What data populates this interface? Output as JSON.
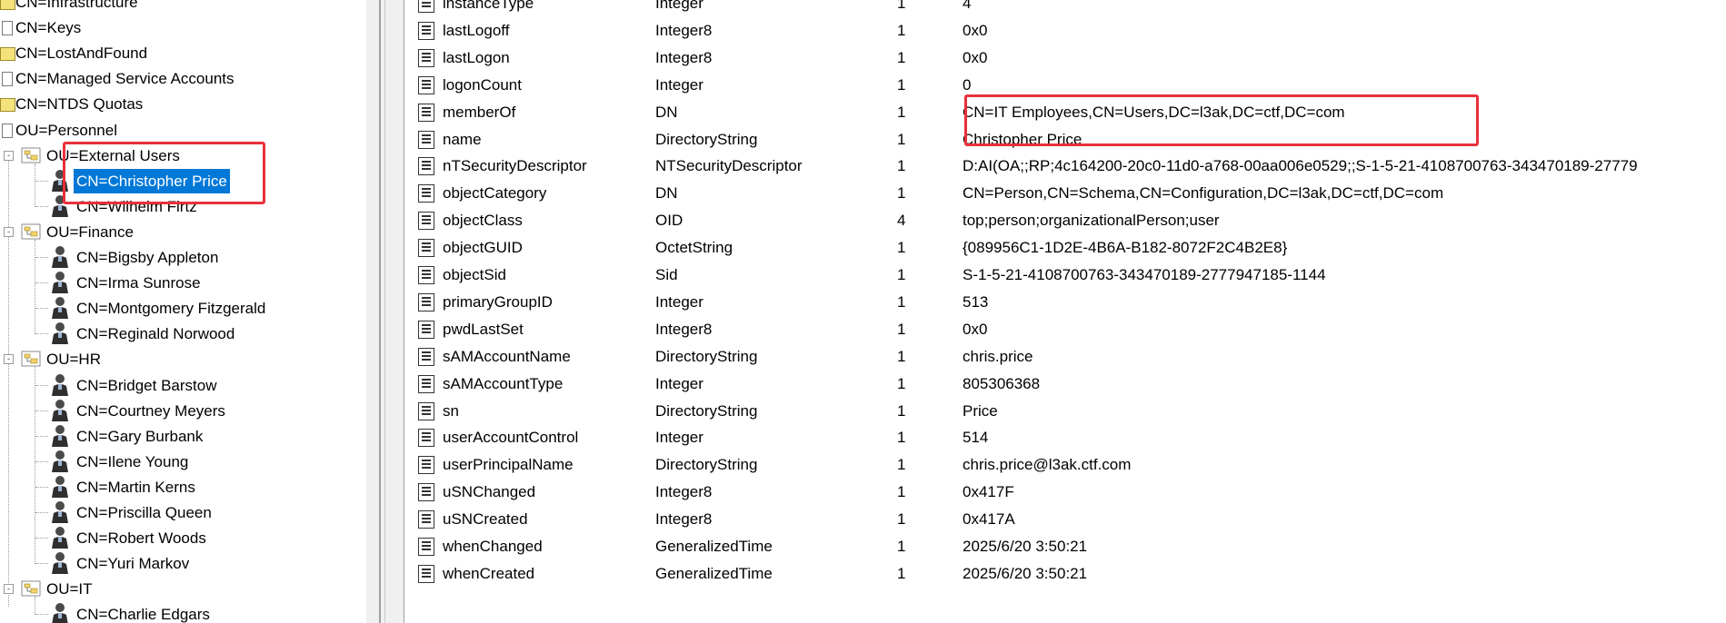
{
  "tree": {
    "items": [
      {
        "label": "CN=Infrastructure",
        "icon": "folder-icon"
      },
      {
        "label": "CN=Keys",
        "icon": "container-icon"
      },
      {
        "label": "CN=LostAndFound",
        "icon": "folder-icon"
      },
      {
        "label": "CN=Managed Service Accounts",
        "icon": "container-icon"
      },
      {
        "label": "CN=NTDS Quotas",
        "icon": "folder-icon"
      },
      {
        "label": "OU=Personnel",
        "icon": "container-icon"
      },
      {
        "label": "OU=External Users",
        "icon": "ou-icon"
      },
      {
        "label": "CN=Christopher Price",
        "icon": "user-icon",
        "selected": true
      },
      {
        "label": "CN=Wilhelm Firtz",
        "icon": "user-icon"
      },
      {
        "label": "OU=Finance",
        "icon": "ou-icon"
      },
      {
        "label": "CN=Bigsby Appleton",
        "icon": "user-icon"
      },
      {
        "label": "CN=Irma Sunrose",
        "icon": "user-icon"
      },
      {
        "label": "CN=Montgomery Fitzgerald",
        "icon": "user-icon"
      },
      {
        "label": "CN=Reginald Norwood",
        "icon": "user-icon"
      },
      {
        "label": "OU=HR",
        "icon": "ou-icon"
      },
      {
        "label": "CN=Bridget Barstow",
        "icon": "user-icon"
      },
      {
        "label": "CN=Courtney Meyers",
        "icon": "user-icon"
      },
      {
        "label": "CN=Gary Burbank",
        "icon": "user-icon"
      },
      {
        "label": "CN=Ilene Young",
        "icon": "user-icon"
      },
      {
        "label": "CN=Martin Kerns",
        "icon": "user-icon"
      },
      {
        "label": "CN=Priscilla Queen",
        "icon": "user-icon"
      },
      {
        "label": "CN=Robert Woods",
        "icon": "user-icon"
      },
      {
        "label": "CN=Yuri Markov",
        "icon": "user-icon"
      },
      {
        "label": "OU=IT",
        "icon": "ou-icon"
      },
      {
        "label": "CN=Charlie Edgars",
        "icon": "user-icon"
      }
    ]
  },
  "attributes": [
    {
      "name": "instanceType",
      "syntax": "Integer",
      "count": "1",
      "value": "4"
    },
    {
      "name": "lastLogoff",
      "syntax": "Integer8",
      "count": "1",
      "value": "0x0"
    },
    {
      "name": "lastLogon",
      "syntax": "Integer8",
      "count": "1",
      "value": "0x0"
    },
    {
      "name": "logonCount",
      "syntax": "Integer",
      "count": "1",
      "value": "0"
    },
    {
      "name": "memberOf",
      "syntax": "DN",
      "count": "1",
      "value": "CN=IT Employees,CN=Users,DC=l3ak,DC=ctf,DC=com"
    },
    {
      "name": "name",
      "syntax": "DirectoryString",
      "count": "1",
      "value": "Christopher Price"
    },
    {
      "name": "nTSecurityDescriptor",
      "syntax": "NTSecurityDescriptor",
      "count": "1",
      "value": "D:AI(OA;;RP;4c164200-20c0-11d0-a768-00aa006e0529;;S-1-5-21-4108700763-343470189-27779"
    },
    {
      "name": "objectCategory",
      "syntax": "DN",
      "count": "1",
      "value": "CN=Person,CN=Schema,CN=Configuration,DC=l3ak,DC=ctf,DC=com"
    },
    {
      "name": "objectClass",
      "syntax": "OID",
      "count": "4",
      "value": "top;person;organizationalPerson;user"
    },
    {
      "name": "objectGUID",
      "syntax": "OctetString",
      "count": "1",
      "value": "{089956C1-1D2E-4B6A-B182-8072F2C4B2E8}"
    },
    {
      "name": "objectSid",
      "syntax": "Sid",
      "count": "1",
      "value": "S-1-5-21-4108700763-343470189-2777947185-1144"
    },
    {
      "name": "primaryGroupID",
      "syntax": "Integer",
      "count": "1",
      "value": "513"
    },
    {
      "name": "pwdLastSet",
      "syntax": "Integer8",
      "count": "1",
      "value": "0x0"
    },
    {
      "name": "sAMAccountName",
      "syntax": "DirectoryString",
      "count": "1",
      "value": "chris.price"
    },
    {
      "name": "sAMAccountType",
      "syntax": "Integer",
      "count": "1",
      "value": "805306368"
    },
    {
      "name": "sn",
      "syntax": "DirectoryString",
      "count": "1",
      "value": "Price"
    },
    {
      "name": "userAccountControl",
      "syntax": "Integer",
      "count": "1",
      "value": "514"
    },
    {
      "name": "userPrincipalName",
      "syntax": "DirectoryString",
      "count": "1",
      "value": "chris.price@l3ak.ctf.com"
    },
    {
      "name": "uSNChanged",
      "syntax": "Integer8",
      "count": "1",
      "value": "0x417F"
    },
    {
      "name": "uSNCreated",
      "syntax": "Integer8",
      "count": "1",
      "value": "0x417A"
    },
    {
      "name": "whenChanged",
      "syntax": "GeneralizedTime",
      "count": "1",
      "value": "2025/6/20 3:50:21"
    },
    {
      "name": "whenCreated",
      "syntax": "GeneralizedTime",
      "count": "1",
      "value": "2025/6/20 3:50:21"
    }
  ],
  "colors": {
    "highlight": "#e8303a",
    "selection": "#0078d7"
  }
}
